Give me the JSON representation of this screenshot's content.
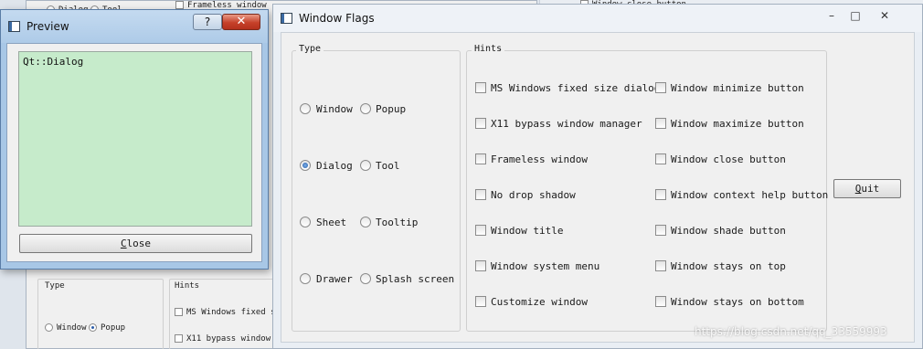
{
  "background": {
    "top_items": [
      "Dialog",
      "Tool",
      "Frameless window",
      "Window close button"
    ],
    "type_label": "Type",
    "hints_label": "Hints",
    "radios": [
      "Window",
      "Popup"
    ],
    "checks": [
      "MS Windows fixed size",
      "X11 bypass window man"
    ]
  },
  "preview": {
    "title": "Preview",
    "help_symbol": "?",
    "close_symbol": "✕",
    "text": "Qt::Dialog",
    "close_mnemonic": "C",
    "close_rest": "lose"
  },
  "flags": {
    "title": "Window Flags",
    "minimize_symbol": "–",
    "maximize_symbol": "□",
    "close_symbol": "✕",
    "type_group": {
      "label": "Type",
      "options": [
        {
          "label": "Window",
          "checked": false
        },
        {
          "label": "Popup",
          "checked": false
        },
        {
          "label": "Dialog",
          "checked": true
        },
        {
          "label": "Tool",
          "checked": false
        },
        {
          "label": "Sheet",
          "checked": false
        },
        {
          "label": "Tooltip",
          "checked": false
        },
        {
          "label": "Drawer",
          "checked": false
        },
        {
          "label": "Splash screen",
          "checked": false
        }
      ]
    },
    "hints_group": {
      "label": "Hints",
      "options": [
        {
          "label": "MS Windows fixed size dialog",
          "checked": false
        },
        {
          "label": "Window minimize button",
          "checked": false
        },
        {
          "label": "X11 bypass window manager",
          "checked": false
        },
        {
          "label": "Window maximize button",
          "checked": false
        },
        {
          "label": "Frameless window",
          "checked": false
        },
        {
          "label": "Window close button",
          "checked": false
        },
        {
          "label": "No drop shadow",
          "checked": false
        },
        {
          "label": "Window context help button",
          "checked": false
        },
        {
          "label": "Window title",
          "checked": false
        },
        {
          "label": "Window shade button",
          "checked": false
        },
        {
          "label": "Window system menu",
          "checked": false
        },
        {
          "label": "Window stays on top",
          "checked": false
        },
        {
          "label": "Customize window",
          "checked": false
        },
        {
          "label": "Window stays on bottom",
          "checked": false
        }
      ]
    },
    "quit_mnemonic": "Q",
    "quit_rest": "uit"
  },
  "watermark": "https://blog.csdn.net/qq_33559993"
}
